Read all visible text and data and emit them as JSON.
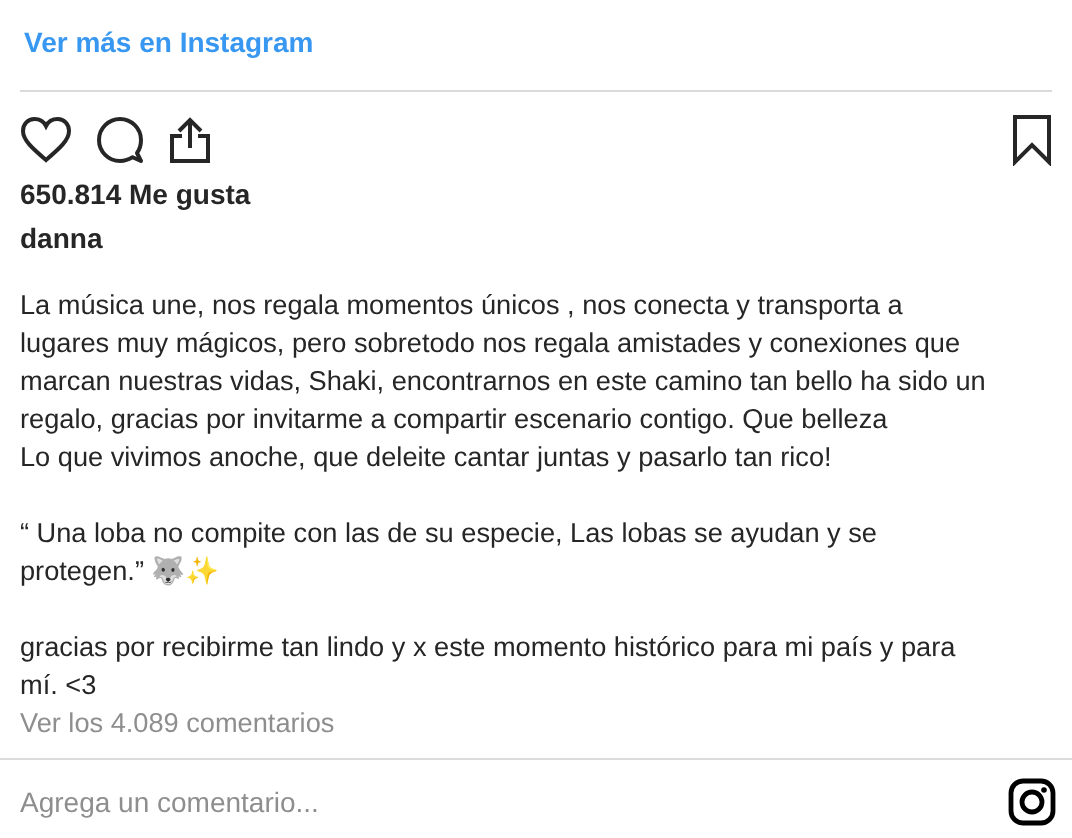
{
  "header_link": "Ver más en Instagram",
  "likes": "650.814 Me gusta",
  "username": "danna",
  "caption_paragraphs": [
    {
      "lines": [
        "La música une, nos regala momentos únicos , nos conecta y transporta a",
        "lugares muy mágicos, pero sobretodo nos regala amistades y conexiones que",
        "marcan nuestras vidas, Shaki, encontrarnos en este camino tan bello ha sido un",
        "regalo, gracias por invitarme a compartir escenario contigo. Que belleza",
        "Lo que vivimos anoche, que deleite cantar juntas y pasarlo tan rico!"
      ]
    },
    {
      "lines": [
        "“ Una loba no compite con las de su especie, Las lobas se ayudan y se",
        "protegen.” 🐺✨"
      ]
    },
    {
      "lines": [
        "gracias por recibirme tan lindo y x este momento histórico para mi país y para",
        "mí. <3"
      ]
    }
  ],
  "view_comments": "Ver los 4.089 comentarios",
  "comment_field": {
    "placeholder": "Agrega un comentario..."
  }
}
